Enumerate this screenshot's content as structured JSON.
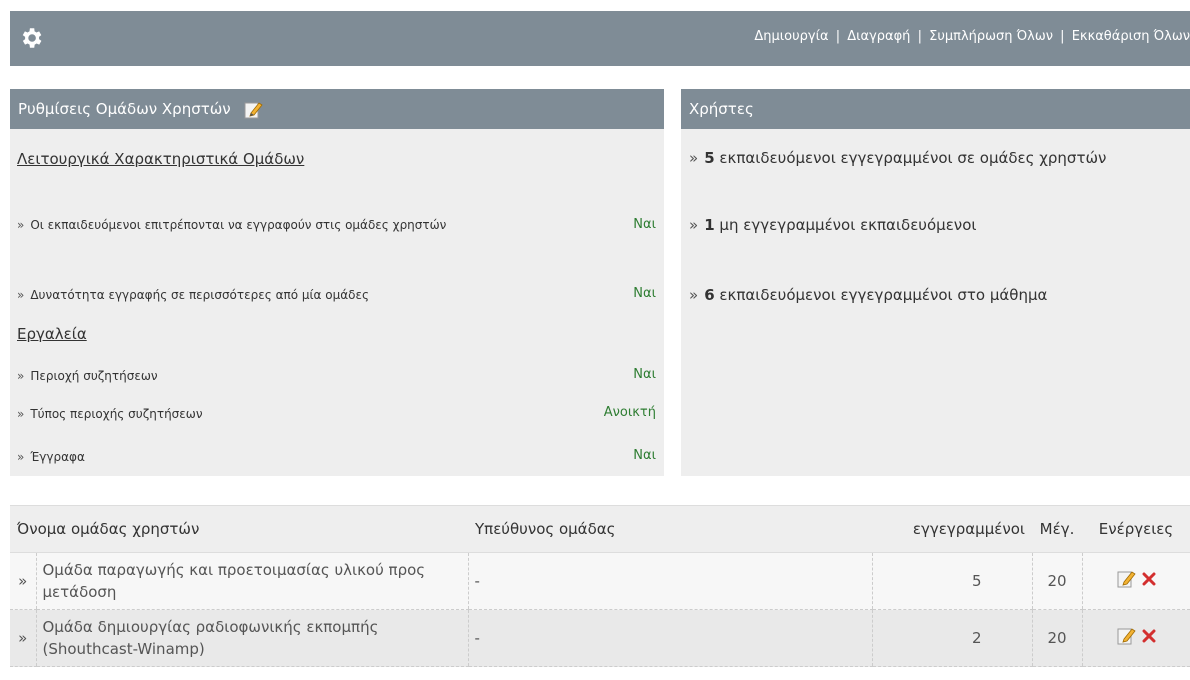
{
  "toolbar": {
    "links": [
      "Δημιουργία",
      "Διαγραφή",
      "Συμπλήρωση Όλων",
      "Εκκαθάριση Όλων"
    ],
    "separator": "|"
  },
  "settings_panel": {
    "title": "Ρυθμίσεις Ομάδων Χρηστών",
    "sections": [
      {
        "title": "Λειτουργικά Χαρακτηριστικά Ομάδων",
        "items": [
          {
            "label": "Οι εκπαιδευόμενοι επιτρέπονται να εγγραφούν στις ομάδες χρηστών",
            "value": "Ναι"
          },
          {
            "label": "Δυνατότητα εγγραφής σε περισσότερες από μία ομάδες",
            "value": "Ναι"
          }
        ]
      },
      {
        "title": "Εργαλεία",
        "items": [
          {
            "label": "Περιοχή συζητήσεων",
            "value": "Ναι"
          },
          {
            "label": "Τύπος περιοχής συζητήσεων",
            "value": "Ανοικτή"
          },
          {
            "label": "Έγγραφα",
            "value": "Ναι"
          }
        ]
      }
    ]
  },
  "users_panel": {
    "title": "Χρήστες",
    "stats": [
      {
        "count": "5",
        "text": "εκπαιδευόμενοι εγγεγραμμένοι σε ομάδες χρηστών"
      },
      {
        "count": "1",
        "text": "μη εγγεγραμμένοι εκπαιδευόμενοι"
      },
      {
        "count": "6",
        "text": "εκπαιδευόμενοι εγγεγραμμένοι στο μάθημα"
      }
    ]
  },
  "groups_table": {
    "headers": {
      "name": "Όνομα ομάδας χρηστών",
      "tutor": "Υπεύθυνος ομάδας",
      "registered": "εγγεγραμμένοι",
      "max": "Μέγ.",
      "actions": "Ενέργειες"
    },
    "rows": [
      {
        "name": "Ομάδα παραγωγής και προετοιμασίας υλικού προς μετάδοση",
        "tutor": "-",
        "registered": "5",
        "max": "20"
      },
      {
        "name": "Ομάδα δημιουργίας ραδιοφωνικής εκπομπής (Shouthcast-Winamp)",
        "tutor": "-",
        "registered": "2",
        "max": "20"
      }
    ]
  },
  "arrow_glyph": "»",
  "icons": {
    "gear": "gear-icon",
    "edit": "pencil-edit-icon",
    "delete": "red-x-delete-icon"
  },
  "colors": {
    "header_bg": "#7f8c96",
    "panel_bg": "#eeeeee",
    "yes_green": "#2e7d32",
    "delete_red": "#d32f2f"
  }
}
